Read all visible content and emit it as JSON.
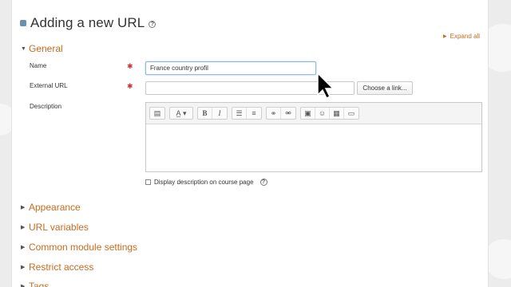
{
  "page": {
    "title": "Adding a new URL",
    "expand_all": "Expand all"
  },
  "sections": {
    "general": "General",
    "appearance": "Appearance",
    "url_variables": "URL variables",
    "common_module_settings": "Common module settings",
    "restrict_access": "Restrict access",
    "tags": "Tags"
  },
  "form": {
    "name_label": "Name",
    "name_value": "France country profil",
    "external_url_label": "External URL",
    "external_url_value": "",
    "choose_link_label": "Choose a link...",
    "description_label": "Description",
    "description_value": "",
    "display_description_label": "Display description on course page",
    "display_description_checked": false
  },
  "editor_toolbar": {
    "groups": [
      [
        "toolbar-toggle-icon"
      ],
      [
        "font-style-icon"
      ],
      [
        "bold-icon",
        "italic-icon"
      ],
      [
        "bullet-list-icon",
        "numbered-list-icon"
      ],
      [
        "link-icon",
        "unlink-icon"
      ],
      [
        "image-icon",
        "emoticon-icon",
        "media-icon",
        "file-icon"
      ]
    ],
    "bold_glyph": "B",
    "italic_glyph": "I"
  },
  "colors": {
    "accent": "#c86b1f",
    "required": "#cc3333",
    "focus": "#8fb8e0"
  }
}
